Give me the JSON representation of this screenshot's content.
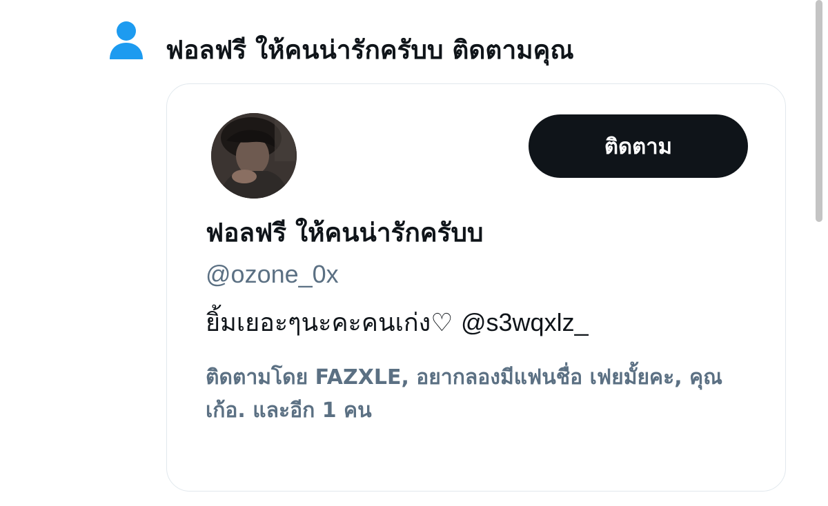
{
  "notification": {
    "icon": "person-icon",
    "icon_color": "#1d9bf0",
    "title": "ฟอลฟรี ให้คนน่ารักครับบ ติดตามคุณ"
  },
  "user_card": {
    "avatar_alt": "profile photo",
    "follow_label": "ติดตาม",
    "display_name": "ฟอลฟรี ให้คนน่ารักครับบ",
    "handle": "@ozone_0x",
    "bio_text": "ยิ้มเยอะๆนะคะคนเก่ง♡",
    "bio_mention": "@s3wqxlz_",
    "followed_by": "ติดตามโดย FAZXLE, อยากลองมีแฟนชื่อ เฟยมั้ยคะ, คุณเก้อ. และอีก 1 คน"
  },
  "colors": {
    "text_primary": "#0f1419",
    "text_secondary": "#5b7083",
    "follow_button_bg": "#0f1419",
    "card_border": "#e1e8ed"
  }
}
